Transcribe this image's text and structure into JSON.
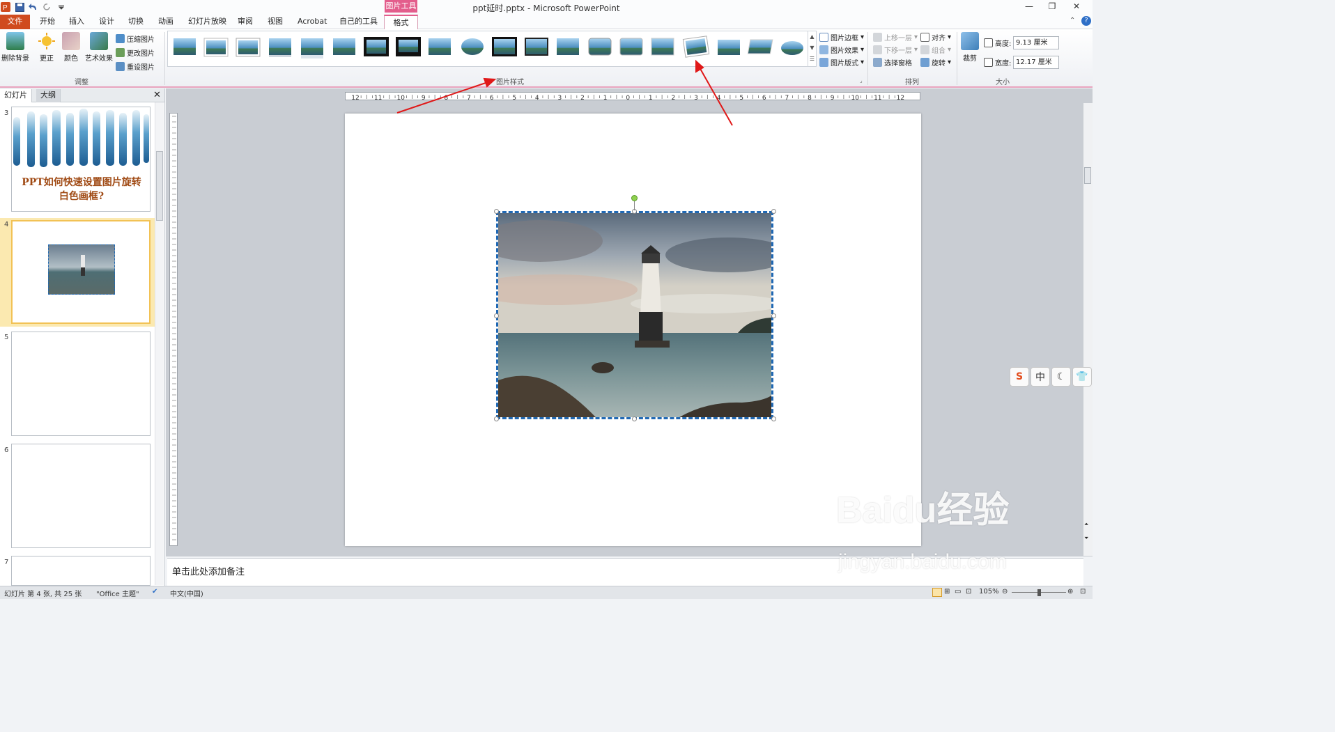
{
  "app_title": "ppt延时.pptx - Microsoft PowerPoint",
  "context_tab_group": "图片工具",
  "tabs": [
    "文件",
    "开始",
    "插入",
    "设计",
    "切换",
    "动画",
    "幻灯片放映",
    "审阅",
    "视图",
    "Acrobat",
    "自己的工具",
    "格式"
  ],
  "ribbon": {
    "adjust": {
      "remove_bg": "删除背景",
      "correct": "更正",
      "color": "颜色",
      "art": "艺术效果",
      "compress": "压缩图片",
      "change": "更改图片",
      "reset": "重设图片",
      "label": "调整"
    },
    "styles_label": "图片样式",
    "style_menu": {
      "border": "图片边框",
      "effects": "图片效果",
      "layout": "图片版式"
    },
    "arrange": {
      "forward": "上移一层",
      "backward": "下移一层",
      "selection": "选择窗格",
      "align": "对齐",
      "group": "组合",
      "rotate": "旋转",
      "label": "排列"
    },
    "size": {
      "crop": "裁剪",
      "height_label": "高度:",
      "height": "9.13 厘米",
      "width_label": "宽度:",
      "width": "12.17 厘米",
      "label": "大小"
    }
  },
  "panel": {
    "tab_slides": "幻灯片",
    "tab_outline": "大纲"
  },
  "slides": [
    {
      "num": "3",
      "title": "PPT如何快速设置图片旋转白色画框?"
    },
    {
      "num": "4"
    },
    {
      "num": "5"
    },
    {
      "num": "6"
    },
    {
      "num": "7"
    }
  ],
  "hruler_labels": [
    "12",
    "11",
    "10",
    "9",
    "8",
    "7",
    "6",
    "5",
    "4",
    "3",
    "2",
    "1",
    "0",
    "1",
    "2",
    "3",
    "4",
    "5",
    "6",
    "7",
    "8",
    "9",
    "10",
    "11",
    "12"
  ],
  "notes_placeholder": "单击此处添加备注",
  "status": {
    "slide": "幻灯片 第 4 张, 共 25 张",
    "theme": "\"Office 主题\"",
    "lang": "中文(中国)",
    "zoom": "105%"
  },
  "ime": {
    "mode": "中"
  },
  "watermark": {
    "main": "Baidu经验",
    "url": "jingyan.baidu.com"
  },
  "colors": {
    "accent_pink": "#e35d8c",
    "file_tab": "#d04b1e",
    "selection": "#1f68b4",
    "arrow": "#e01818"
  }
}
